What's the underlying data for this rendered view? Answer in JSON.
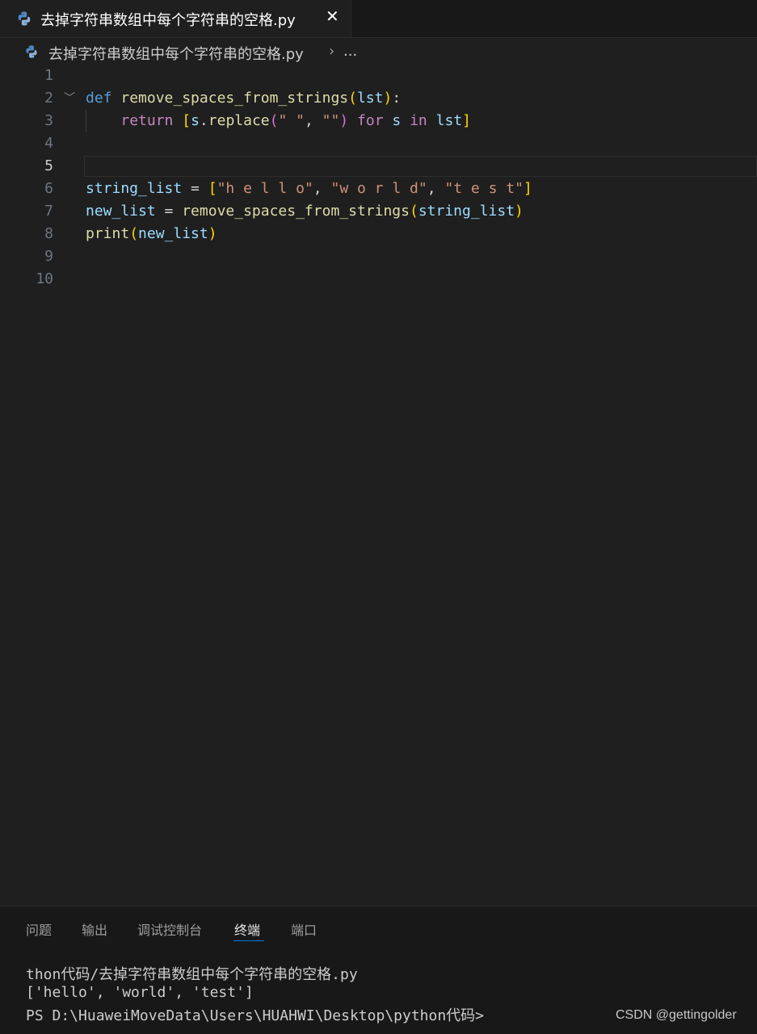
{
  "tab": {
    "label": "去掉字符串数组中每个字符串的空格.py",
    "close": "✕"
  },
  "breadcrumb": {
    "file": "去掉字符串数组中每个字符串的空格.py",
    "sep": "›",
    "more": "..."
  },
  "editor": {
    "active_line": 5,
    "line_numbers": [
      "1",
      "2",
      "3",
      "4",
      "5",
      "6",
      "7",
      "8",
      "9",
      "10"
    ],
    "fold_marker": "﹀",
    "code": {
      "l2": {
        "def": "def",
        "fname": "remove_spaces_from_strings",
        "open": "(",
        "param": "lst",
        "close": ")",
        "colon": ":"
      },
      "l3": {
        "indent": "    ",
        "return": "return",
        "sp": " ",
        "lb": "[",
        "s1": "s",
        "dot": ".",
        "replace": "replace",
        "po": "(",
        "a1": "\" \"",
        "comma": ", ",
        "a2": "\"\"",
        "pc": ")",
        "sp2": " ",
        "for": "for",
        "sp3": " ",
        "s2": "s",
        "sp4": " ",
        "in": "in",
        "sp5": " ",
        "lst": "lst",
        "rb": "]"
      },
      "l6": {
        "var": "string_list",
        "eq": " = ",
        "lb": "[",
        "v1": "\"h e l l o\"",
        "c1": ", ",
        "v2": "\"w o r l d\"",
        "c2": ", ",
        "v3": "\"t e s t\"",
        "rb": "]"
      },
      "l7": {
        "var": "new_list",
        "eq": " = ",
        "fn": "remove_spaces_from_strings",
        "po": "(",
        "arg": "string_list",
        "pc": ")"
      },
      "l8": {
        "fn": "print",
        "po": "(",
        "arg": "new_list",
        "pc": ")"
      }
    }
  },
  "panel": {
    "tabs": [
      "问题",
      "输出",
      "调试控制台",
      "终端",
      "端口"
    ],
    "active_tab": "终端",
    "terminal": [
      "thon代码/去掉字符串数组中每个字符串的空格.py",
      "['hello', 'world', 'test']",
      "PS D:\\HuaweiMoveData\\Users\\HUAHWI\\Desktop\\python代码>"
    ]
  },
  "watermark": "CSDN @gettingolder",
  "colors": {
    "keyword": "#569cd6",
    "control": "#c586c0",
    "function": "#dcdcaa",
    "variable": "#9cdcfe",
    "string": "#ce9178",
    "bracket": "#ffd700",
    "accent": "#0078d4"
  },
  "icons": {
    "file_type": "python-icon"
  }
}
